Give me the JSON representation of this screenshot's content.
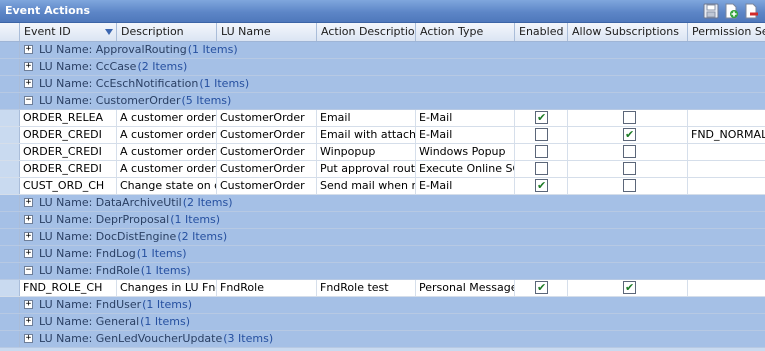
{
  "window": {
    "title": "Event Actions"
  },
  "toolbar": {
    "icons": [
      "save-icon",
      "new-icon",
      "delete-icon"
    ]
  },
  "columns": [
    "Event ID",
    "Description",
    "LU Name",
    "Action Description",
    "Action Type",
    "Enabled",
    "Allow Subscriptions",
    "Permission Set"
  ],
  "groups": [
    {
      "label": "LU Name: ApprovalRouting",
      "count": "(1 Items)",
      "expanded": false
    },
    {
      "label": "LU Name: CcCase",
      "count": "(2 Items)",
      "expanded": false
    },
    {
      "label": "LU Name: CcEschNotification",
      "count": "(1 Items)",
      "expanded": false
    },
    {
      "label": "LU Name: CustomerOrder",
      "count": "(5 Items)",
      "expanded": true,
      "rows": [
        {
          "event_id": "ORDER_RELEA",
          "description": "A customer order h",
          "lu_name": "CustomerOrder",
          "action_description": "Email",
          "action_type": "E-Mail",
          "enabled": true,
          "allow_subscriptions": false,
          "permission_set": ""
        },
        {
          "event_id": "ORDER_CREDI",
          "description": "A customer order h",
          "lu_name": "CustomerOrder",
          "action_description": "Email with attachm",
          "action_type": "E-Mail",
          "enabled": false,
          "allow_subscriptions": true,
          "permission_set": "FND_NORMAL"
        },
        {
          "event_id": "ORDER_CREDI",
          "description": "A customer order h",
          "lu_name": "CustomerOrder",
          "action_description": "Winpopup",
          "action_type": "Windows Popup",
          "enabled": false,
          "allow_subscriptions": false,
          "permission_set": ""
        },
        {
          "event_id": "ORDER_CREDI",
          "description": "A customer order h",
          "lu_name": "CustomerOrder",
          "action_description": "Put approval route",
          "action_type": "Execute Online SQ",
          "enabled": false,
          "allow_subscriptions": false,
          "permission_set": ""
        },
        {
          "event_id": "CUST_ORD_CH",
          "description": "Change state on cu",
          "lu_name": "CustomerOrder",
          "action_description": "Send mail when ro",
          "action_type": "E-Mail",
          "enabled": true,
          "allow_subscriptions": false,
          "permission_set": ""
        }
      ]
    },
    {
      "label": "LU Name: DataArchiveUtil",
      "count": "(2 Items)",
      "expanded": false
    },
    {
      "label": "LU Name: DeprProposal",
      "count": "(1 Items)",
      "expanded": false
    },
    {
      "label": "LU Name: DocDistEngine",
      "count": "(2 Items)",
      "expanded": false
    },
    {
      "label": "LU Name: FndLog",
      "count": "(1 Items)",
      "expanded": false
    },
    {
      "label": "LU Name: FndRole",
      "count": "(1 Items)",
      "expanded": true,
      "rows": [
        {
          "event_id": "FND_ROLE_CH",
          "description": "Changes in LU Fnd",
          "lu_name": "FndRole",
          "action_description": "FndRole test",
          "action_type": "Personal Message",
          "enabled": true,
          "allow_subscriptions": true,
          "permission_set": ""
        }
      ]
    },
    {
      "label": "LU Name: FndUser",
      "count": "(1 Items)",
      "expanded": false
    },
    {
      "label": "LU Name: General",
      "count": "(1 Items)",
      "expanded": false
    },
    {
      "label": "LU Name: GenLedVoucherUpdate",
      "count": "(3 Items)",
      "expanded": false
    }
  ]
}
